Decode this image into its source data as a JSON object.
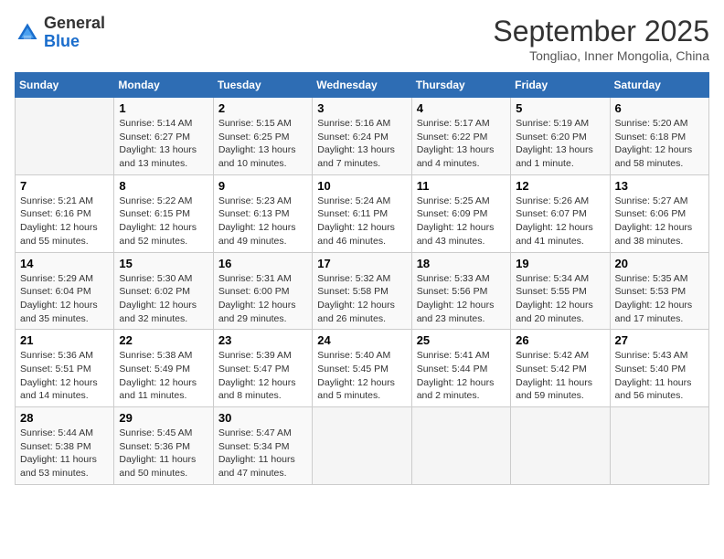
{
  "header": {
    "logo_general": "General",
    "logo_blue": "Blue",
    "month": "September 2025",
    "location": "Tongliao, Inner Mongolia, China"
  },
  "weekdays": [
    "Sunday",
    "Monday",
    "Tuesday",
    "Wednesday",
    "Thursday",
    "Friday",
    "Saturday"
  ],
  "weeks": [
    [
      {
        "day": "",
        "sunrise": "",
        "sunset": "",
        "daylight": ""
      },
      {
        "day": "1",
        "sunrise": "Sunrise: 5:14 AM",
        "sunset": "Sunset: 6:27 PM",
        "daylight": "Daylight: 13 hours and 13 minutes."
      },
      {
        "day": "2",
        "sunrise": "Sunrise: 5:15 AM",
        "sunset": "Sunset: 6:25 PM",
        "daylight": "Daylight: 13 hours and 10 minutes."
      },
      {
        "day": "3",
        "sunrise": "Sunrise: 5:16 AM",
        "sunset": "Sunset: 6:24 PM",
        "daylight": "Daylight: 13 hours and 7 minutes."
      },
      {
        "day": "4",
        "sunrise": "Sunrise: 5:17 AM",
        "sunset": "Sunset: 6:22 PM",
        "daylight": "Daylight: 13 hours and 4 minutes."
      },
      {
        "day": "5",
        "sunrise": "Sunrise: 5:19 AM",
        "sunset": "Sunset: 6:20 PM",
        "daylight": "Daylight: 13 hours and 1 minute."
      },
      {
        "day": "6",
        "sunrise": "Sunrise: 5:20 AM",
        "sunset": "Sunset: 6:18 PM",
        "daylight": "Daylight: 12 hours and 58 minutes."
      }
    ],
    [
      {
        "day": "7",
        "sunrise": "Sunrise: 5:21 AM",
        "sunset": "Sunset: 6:16 PM",
        "daylight": "Daylight: 12 hours and 55 minutes."
      },
      {
        "day": "8",
        "sunrise": "Sunrise: 5:22 AM",
        "sunset": "Sunset: 6:15 PM",
        "daylight": "Daylight: 12 hours and 52 minutes."
      },
      {
        "day": "9",
        "sunrise": "Sunrise: 5:23 AM",
        "sunset": "Sunset: 6:13 PM",
        "daylight": "Daylight: 12 hours and 49 minutes."
      },
      {
        "day": "10",
        "sunrise": "Sunrise: 5:24 AM",
        "sunset": "Sunset: 6:11 PM",
        "daylight": "Daylight: 12 hours and 46 minutes."
      },
      {
        "day": "11",
        "sunrise": "Sunrise: 5:25 AM",
        "sunset": "Sunset: 6:09 PM",
        "daylight": "Daylight: 12 hours and 43 minutes."
      },
      {
        "day": "12",
        "sunrise": "Sunrise: 5:26 AM",
        "sunset": "Sunset: 6:07 PM",
        "daylight": "Daylight: 12 hours and 41 minutes."
      },
      {
        "day": "13",
        "sunrise": "Sunrise: 5:27 AM",
        "sunset": "Sunset: 6:06 PM",
        "daylight": "Daylight: 12 hours and 38 minutes."
      }
    ],
    [
      {
        "day": "14",
        "sunrise": "Sunrise: 5:29 AM",
        "sunset": "Sunset: 6:04 PM",
        "daylight": "Daylight: 12 hours and 35 minutes."
      },
      {
        "day": "15",
        "sunrise": "Sunrise: 5:30 AM",
        "sunset": "Sunset: 6:02 PM",
        "daylight": "Daylight: 12 hours and 32 minutes."
      },
      {
        "day": "16",
        "sunrise": "Sunrise: 5:31 AM",
        "sunset": "Sunset: 6:00 PM",
        "daylight": "Daylight: 12 hours and 29 minutes."
      },
      {
        "day": "17",
        "sunrise": "Sunrise: 5:32 AM",
        "sunset": "Sunset: 5:58 PM",
        "daylight": "Daylight: 12 hours and 26 minutes."
      },
      {
        "day": "18",
        "sunrise": "Sunrise: 5:33 AM",
        "sunset": "Sunset: 5:56 PM",
        "daylight": "Daylight: 12 hours and 23 minutes."
      },
      {
        "day": "19",
        "sunrise": "Sunrise: 5:34 AM",
        "sunset": "Sunset: 5:55 PM",
        "daylight": "Daylight: 12 hours and 20 minutes."
      },
      {
        "day": "20",
        "sunrise": "Sunrise: 5:35 AM",
        "sunset": "Sunset: 5:53 PM",
        "daylight": "Daylight: 12 hours and 17 minutes."
      }
    ],
    [
      {
        "day": "21",
        "sunrise": "Sunrise: 5:36 AM",
        "sunset": "Sunset: 5:51 PM",
        "daylight": "Daylight: 12 hours and 14 minutes."
      },
      {
        "day": "22",
        "sunrise": "Sunrise: 5:38 AM",
        "sunset": "Sunset: 5:49 PM",
        "daylight": "Daylight: 12 hours and 11 minutes."
      },
      {
        "day": "23",
        "sunrise": "Sunrise: 5:39 AM",
        "sunset": "Sunset: 5:47 PM",
        "daylight": "Daylight: 12 hours and 8 minutes."
      },
      {
        "day": "24",
        "sunrise": "Sunrise: 5:40 AM",
        "sunset": "Sunset: 5:45 PM",
        "daylight": "Daylight: 12 hours and 5 minutes."
      },
      {
        "day": "25",
        "sunrise": "Sunrise: 5:41 AM",
        "sunset": "Sunset: 5:44 PM",
        "daylight": "Daylight: 12 hours and 2 minutes."
      },
      {
        "day": "26",
        "sunrise": "Sunrise: 5:42 AM",
        "sunset": "Sunset: 5:42 PM",
        "daylight": "Daylight: 11 hours and 59 minutes."
      },
      {
        "day": "27",
        "sunrise": "Sunrise: 5:43 AM",
        "sunset": "Sunset: 5:40 PM",
        "daylight": "Daylight: 11 hours and 56 minutes."
      }
    ],
    [
      {
        "day": "28",
        "sunrise": "Sunrise: 5:44 AM",
        "sunset": "Sunset: 5:38 PM",
        "daylight": "Daylight: 11 hours and 53 minutes."
      },
      {
        "day": "29",
        "sunrise": "Sunrise: 5:45 AM",
        "sunset": "Sunset: 5:36 PM",
        "daylight": "Daylight: 11 hours and 50 minutes."
      },
      {
        "day": "30",
        "sunrise": "Sunrise: 5:47 AM",
        "sunset": "Sunset: 5:34 PM",
        "daylight": "Daylight: 11 hours and 47 minutes."
      },
      {
        "day": "",
        "sunrise": "",
        "sunset": "",
        "daylight": ""
      },
      {
        "day": "",
        "sunrise": "",
        "sunset": "",
        "daylight": ""
      },
      {
        "day": "",
        "sunrise": "",
        "sunset": "",
        "daylight": ""
      },
      {
        "day": "",
        "sunrise": "",
        "sunset": "",
        "daylight": ""
      }
    ]
  ]
}
